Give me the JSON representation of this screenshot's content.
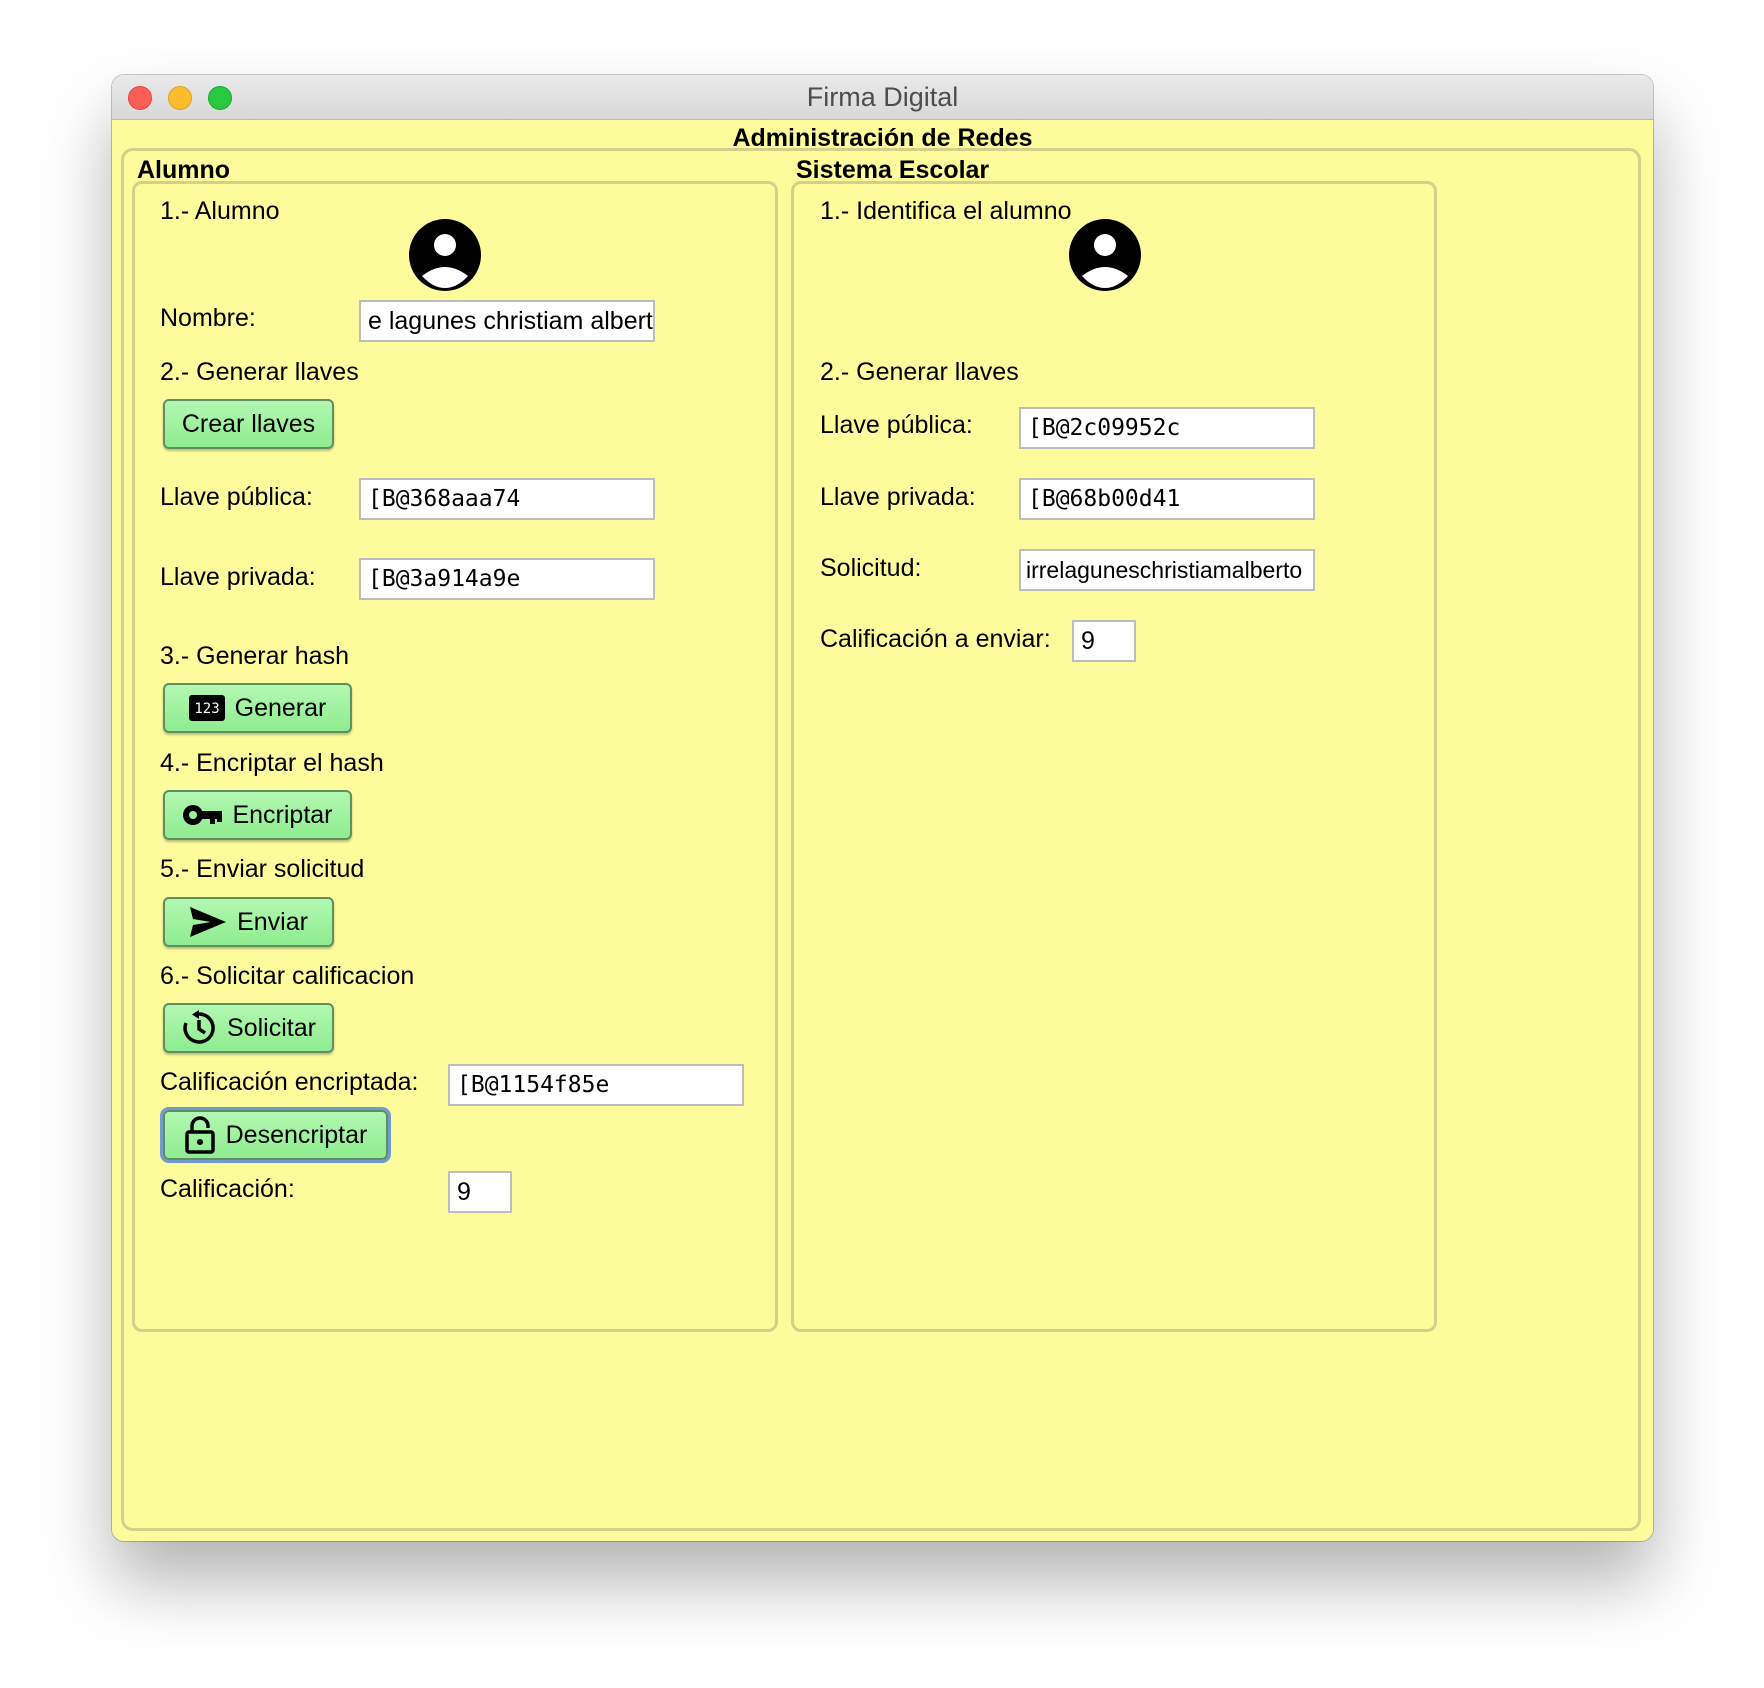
{
  "window": {
    "title": "Firma Digital"
  },
  "group_title": "Administración de Redes",
  "alumno": {
    "section_title": "Alumno",
    "step1": "1.- Alumno",
    "nombre_label": "Nombre:",
    "nombre_value": "e lagunes christiam alberto",
    "step2": "2.- Generar llaves",
    "crear_llaves_button": "Crear llaves",
    "llave_publica_label": "Llave pública:",
    "llave_publica_value": "[B@368aaa74",
    "llave_privada_label": "Llave privada:",
    "llave_privada_value": "[B@3a914a9e",
    "step3": "3.- Generar hash",
    "generar_button": "Generar",
    "step4": "4.- Encriptar el hash",
    "encriptar_button": "Encriptar",
    "step5": "5.- Enviar solicitud",
    "enviar_button": "Enviar",
    "step6": "6.- Solicitar calificacion",
    "solicitar_button": "Solicitar",
    "calificacion_encriptada_label": "Calificación encriptada:",
    "calificacion_encriptada_value": "[B@1154f85e",
    "desencriptar_button": "Desencriptar",
    "calificacion_label": "Calificación:",
    "calificacion_value": "9"
  },
  "sistema": {
    "section_title": "Sistema Escolar",
    "step1": "1.- Identifica el alumno",
    "step2": "2.- Generar llaves",
    "llave_publica_label": "Llave pública:",
    "llave_publica_value": "[B@2c09952c",
    "llave_privada_label": "Llave privada:",
    "llave_privada_value": "[B@68b00d41",
    "solicitud_label": "Solicitud:",
    "solicitud_value": "irrelaguneschristiamalberto",
    "calificacion_enviar_label": "Calificación a enviar:",
    "calificacion_enviar_value": "9"
  },
  "icons": {
    "avatar": "user-avatar-icon",
    "generar": "numbers-icon",
    "encriptar": "key-icon",
    "enviar": "send-icon",
    "solicitar": "history-icon",
    "desencriptar": "lock-open-icon"
  },
  "colors": {
    "background": "#fdfc9c",
    "button": "#9ff09f",
    "border": "#d2d18a"
  }
}
